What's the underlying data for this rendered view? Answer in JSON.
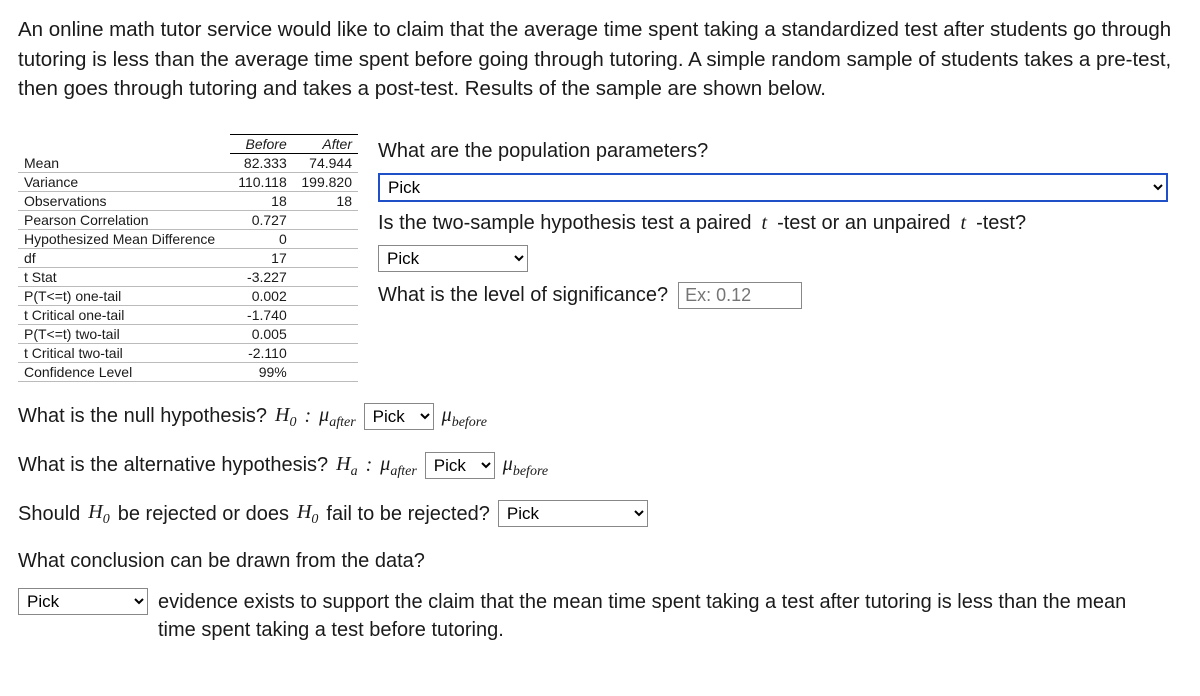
{
  "intro": "An online math tutor service would like to claim that the average time spent taking a standardized test after students go through tutoring is less than the average time spent before going through tutoring. A simple random sample of students takes a pre-test, then goes through tutoring and takes a post-test. Results of the sample are shown below.",
  "table": {
    "headers": {
      "blank": "",
      "before": "Before",
      "after": "After"
    },
    "rows": [
      {
        "label": "Mean",
        "before": "82.333",
        "after": "74.944"
      },
      {
        "label": "Variance",
        "before": "110.118",
        "after": "199.820"
      },
      {
        "label": "Observations",
        "before": "18",
        "after": "18"
      },
      {
        "label": "Pearson Correlation",
        "before": "0.727",
        "after": ""
      },
      {
        "label": "Hypothesized Mean Difference",
        "before": "0",
        "after": ""
      },
      {
        "label": "df",
        "before": "17",
        "after": ""
      },
      {
        "label": "t Stat",
        "before": "-3.227",
        "after": ""
      },
      {
        "label": "P(T<=t) one-tail",
        "before": "0.002",
        "after": ""
      },
      {
        "label": "t Critical one-tail",
        "before": "-1.740",
        "after": ""
      },
      {
        "label": "P(T<=t) two-tail",
        "before": "0.005",
        "after": ""
      },
      {
        "label": "t Critical two-tail",
        "before": "-2.110",
        "after": ""
      },
      {
        "label": "Confidence Level",
        "before": "99%",
        "after": ""
      }
    ]
  },
  "questions": {
    "q1": "What are the population parameters?",
    "q2_a": "Is the two-sample hypothesis test a paired ",
    "q2_b": "-test or an unpaired ",
    "q2_c": "-test?",
    "q3": "What is the level of significance?",
    "q3_ph": "Ex: 0.12",
    "q4": "What is the null hypothesis? ",
    "q5": "What is the alternative hypothesis? ",
    "q6_a": "Should ",
    "q6_b": " be rejected or does ",
    "q6_c": " fail to be rejected?",
    "q7": "What conclusion can be drawn from the data?",
    "q7_tail": "evidence exists to support the claim that the mean time spent taking a test after tutoring is less than the mean time spent taking a test before tutoring."
  },
  "sym": {
    "H0": "H",
    "H0sub": "0",
    "Ha": "H",
    "Hasub": "a",
    "mu": "μ",
    "after": "after",
    "before": "before",
    "t": "t",
    "colon": " : "
  },
  "pick": "Pick"
}
